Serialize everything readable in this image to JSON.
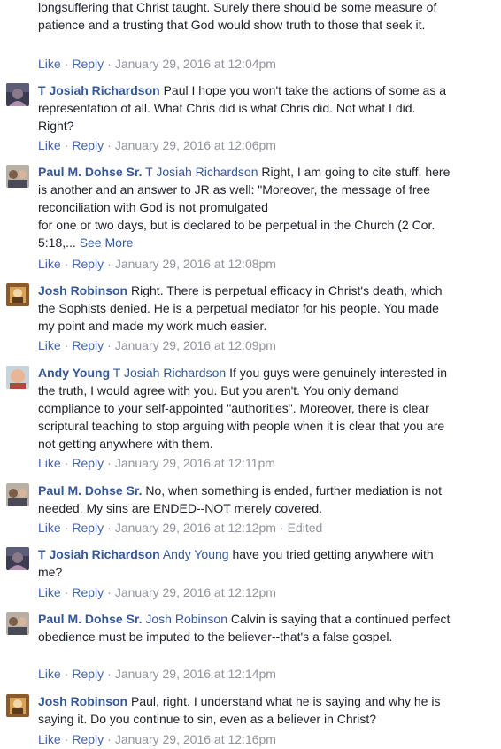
{
  "top_fragment": {
    "text": "longsuffering that Christ taught. Surely there should be some measure of patience and a trusting that God would show truth to those that seek it.",
    "timestamp": "January 29, 2016 at 12:04pm"
  },
  "actions": {
    "like": "Like",
    "reply": "Reply",
    "dot": "·",
    "see_more": "See More",
    "edited": "Edited"
  },
  "comments": [
    {
      "author": "T Josiah Richardson",
      "text": "Paul I hope you won't take the actions of some as a representation of all. What Chris did is what Chris did. Not what I did. Right?",
      "timestamp": "January 29, 2016 at 12:06pm"
    },
    {
      "author": "Paul M. Dohse Sr.",
      "tag": "T Josiah Richardson",
      "text": "Right, I am going to cite stuff, here is another and an answer to JR as well: \"Moreover, the message of free reconciliation with God is not promulgated",
      "text2": "for one or two days, but is declared to be perpetual in the Church (2 Cor. 5:18,...",
      "timestamp": "January 29, 2016 at 12:08pm"
    },
    {
      "author": "Josh Robinson",
      "text": "Right. There is perpetual efficacy in Christ's death, which the Sophists denied. He is a perpetual mediator for his people. You made my point and made my work much easier.",
      "timestamp": "January 29, 2016 at 12:09pm"
    },
    {
      "author": "Andy Young",
      "tag": "T Josiah Richardson",
      "text": "If you guys were genuinely interested in the truth, I would agree with you. But you aren't. You only demand compliance to your self-appointed \"authorities\". Moreover, there is clear scriptural teaching to stop arguing with people when it is clear that you are not getting anywhere with them.",
      "timestamp": "January 29, 2016 at 12:11pm"
    },
    {
      "author": "Paul M. Dohse Sr.",
      "text": "No, when something is ended, further mediation is not needed. My sins are ENDED--NOT merely covered.",
      "timestamp": "January 29, 2016 at 12:12pm"
    },
    {
      "author": "T Josiah Richardson",
      "tag": "Andy Young",
      "text": "have you tried getting anywhere with me?",
      "timestamp": "January 29, 2016 at 12:12pm"
    },
    {
      "author": "Paul M. Dohse Sr.",
      "tag": "Josh Robinson",
      "text": "Calvin is saying that a continued perfect obedience must be imputed to the believer--that's a false gospel.",
      "timestamp": "January 29, 2016 at 12:14pm"
    },
    {
      "author": "Josh Robinson",
      "text": "Paul, right. I understand what he is saying and why he is saying it. Do you continue to sin, even as a believer in Christ?",
      "timestamp": "January 29, 2016 at 12:16pm"
    }
  ],
  "colors": {
    "link": "#365899",
    "action": "#4267b2",
    "meta": "#90949c",
    "text": "#1d2129"
  }
}
